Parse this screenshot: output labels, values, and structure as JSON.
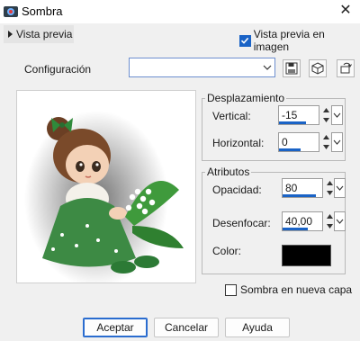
{
  "window": {
    "title": "Sombra",
    "close_glyph": "✕"
  },
  "preview_bar": {
    "toggle_label": "Vista previa",
    "checkbox_label": "Vista previa en imagen",
    "checkbox_checked": true
  },
  "config": {
    "label": "Configuración",
    "value": ""
  },
  "offset_group": {
    "title": "Desplazamiento",
    "vertical_label": "Vertical:",
    "vertical_value": "-15",
    "horizontal_label": "Horizontal:",
    "horizontal_value": "0"
  },
  "attributes_group": {
    "title": "Atributos",
    "opacity_label": "Opacidad:",
    "opacity_value": "80",
    "blur_label": "Desenfocar:",
    "blur_value": "40,00",
    "color_label": "Color:",
    "color_hex": "#000000"
  },
  "new_layer": {
    "label": "Sombra en nueva capa",
    "checked": false
  },
  "buttons": {
    "ok": "Aceptar",
    "cancel": "Cancelar",
    "help": "Ayuda"
  },
  "colors": {
    "accent": "#1a63c6",
    "window_bg": "#f0f0f0"
  },
  "icons": [
    "app-icon",
    "close-icon",
    "save-icon",
    "cube-icon",
    "reset-icon",
    "chevron-down-icon",
    "spin-up-icon",
    "spin-down-icon"
  ]
}
